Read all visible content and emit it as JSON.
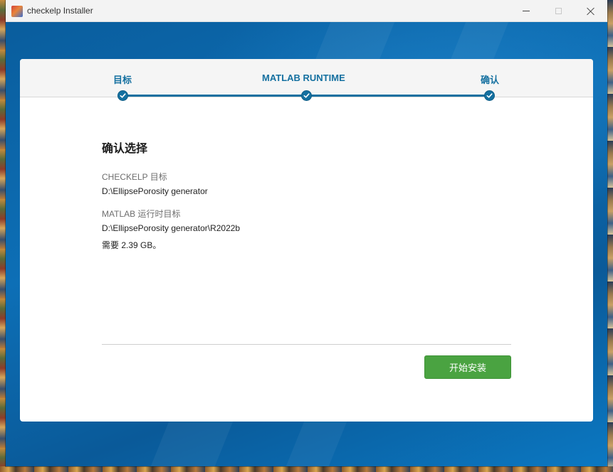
{
  "window": {
    "title": "checkelp Installer",
    "icons": {
      "app": "app-icon",
      "minimize": "minimize-icon",
      "maximize": "maximize-icon",
      "close": "close-icon"
    }
  },
  "stepper": {
    "steps": [
      {
        "label": "目标",
        "status": "complete"
      },
      {
        "label": "MATLAB RUNTIME",
        "status": "complete"
      },
      {
        "label": "确认",
        "status": "complete"
      }
    ],
    "accent_color": "#1470a0"
  },
  "main": {
    "heading": "确认选择",
    "fields": [
      {
        "label": "CHECKELP 目标",
        "value": "D:\\EllipsePorosity generator"
      },
      {
        "label": "MATLAB 运行时目标",
        "value": "D:\\EllipsePorosity generator\\R2022b"
      }
    ],
    "required_space": "需要 2.39 GB。"
  },
  "footer": {
    "install_button_label": "开始安装",
    "install_button_color": "#4aa341"
  }
}
